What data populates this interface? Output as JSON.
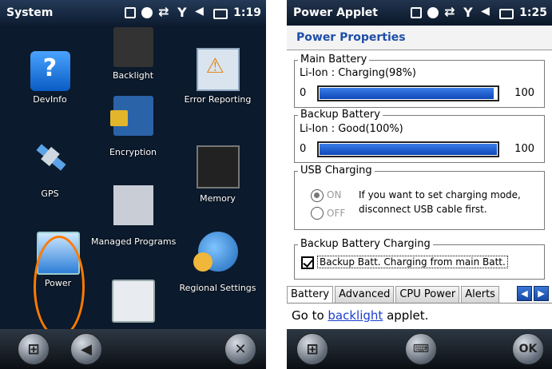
{
  "left": {
    "title": "System",
    "time": "1:19",
    "apps": [
      {
        "label": "Backlight",
        "icon": "backlight-icon"
      },
      {
        "label": "DevInfo",
        "icon": "question-mark-icon"
      },
      {
        "label": "Error Reporting",
        "icon": "error-reporting-icon"
      },
      {
        "label": "Encryption",
        "icon": "encryption-lock-icon"
      },
      {
        "label": "GPS",
        "icon": "satellite-icon"
      },
      {
        "label": "Memory",
        "icon": "memory-chip-icon"
      },
      {
        "label": "Managed Programs",
        "icon": "managed-programs-icon"
      },
      {
        "label": "Power",
        "icon": "battery-icon"
      },
      {
        "label": "Regional Settings",
        "icon": "globe-clock-icon"
      },
      {
        "label": "",
        "icon": "device-icon"
      }
    ],
    "softkeys": {
      "start": "windows-start-icon",
      "back": "back-arrow-icon",
      "close": "close-x-icon"
    }
  },
  "right": {
    "title": "Power Applet",
    "time": "1:25",
    "header": "Power Properties",
    "main_battery": {
      "legend": "Main Battery",
      "status": "Li-Ion : Charging(98%)",
      "min": "0",
      "max": "100",
      "level": 98
    },
    "backup_battery": {
      "legend": "Backup Battery",
      "status": "Li-Ion : Good(100%)",
      "min": "0",
      "max": "100",
      "level": 100
    },
    "usb": {
      "legend": "USB Charging",
      "on_label": "ON",
      "off_label": "OFF",
      "note_line1": "If you want to set charging mode,",
      "note_line2": "disconnect USB cable first."
    },
    "backup_charging": {
      "legend": "Backup Battery Charging",
      "checkbox_label": "Backup Batt. Charging from main Batt."
    },
    "tabs": [
      "Battery",
      "Advanced",
      "CPU Power",
      "Alerts"
    ],
    "link_prefix": "Go to ",
    "link_text": "backlight",
    "link_suffix": " applet.",
    "softkeys": {
      "start": "windows-start-icon",
      "keyboard": "keyboard-icon",
      "ok": "OK"
    }
  }
}
